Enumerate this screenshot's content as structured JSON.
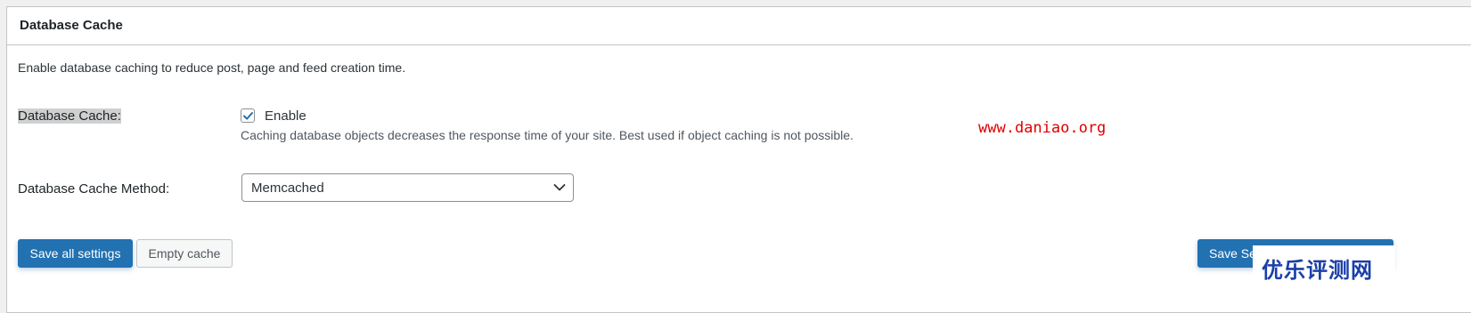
{
  "panel": {
    "title": "Database Cache",
    "intro": "Enable database caching to reduce post, page and feed creation time."
  },
  "enable_row": {
    "label": "Database Cache:",
    "checkbox_checked": true,
    "checkbox_label": "Enable",
    "description": "Caching database objects decreases the response time of your site. Best used if object caching is not possible."
  },
  "method_row": {
    "label": "Database Cache Method:",
    "selected": "Memcached"
  },
  "buttons": {
    "save_all": "Save all settings",
    "empty_cache": "Empty cache",
    "save_settings": "Save Se"
  },
  "overlays": {
    "watermark": "www.daniao.org",
    "logo": "优乐评测网"
  },
  "colors": {
    "primary": "#2271b1",
    "watermark": "#e00000",
    "logo": "#1a3fa8"
  }
}
